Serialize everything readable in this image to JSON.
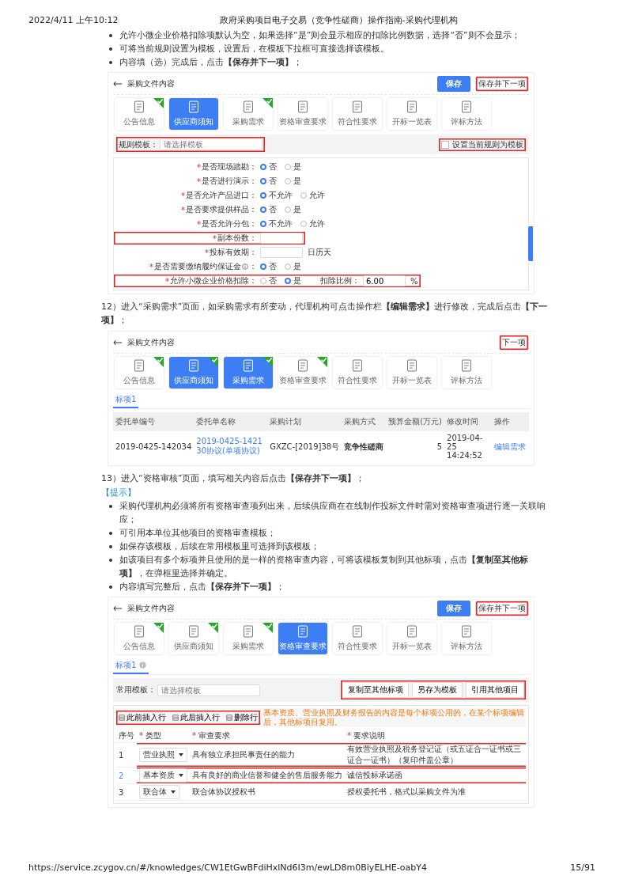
{
  "header": {
    "date": "2022/4/11 上午10:12",
    "title": "政府采购项目电子交易（竞争性磋商）操作指南-采购代理机构"
  },
  "content": [
    {
      "kind": "bullets",
      "items": [
        "允许小微企业价格扣除项默认为空，如果选择“是”则会显示相应的扣除比例数据，选择“否”则不会显示；",
        "可将当前规则设置为模板，设置后，在模板下拉框可直接选择该模板。",
        "内容填（选）完成后，点击**【保存并下一项】**；"
      ]
    },
    {
      "kind": "screenshot",
      "title": "采购文件内容",
      "buttons": [
        {
          "label": "保存",
          "kind": "primary",
          "highlighted": false
        },
        {
          "label": "保存并下一项",
          "kind": "default",
          "highlighted": true
        }
      ],
      "steps": [
        {
          "label": "公告信息",
          "done": true,
          "selected": false
        },
        {
          "label": "供应商须知",
          "done": false,
          "selected": true
        },
        {
          "label": "采购需求",
          "done": true,
          "selected": false
        },
        {
          "label": "资格审查要求",
          "done": false,
          "selected": false
        },
        {
          "label": "符合性要求",
          "done": false,
          "selected": false
        },
        {
          "label": "开标一览表",
          "done": false,
          "selected": false
        },
        {
          "label": "评标方法",
          "done": false,
          "selected": false
        }
      ],
      "template_bar": {
        "label": "规则模板：",
        "placeholder": "请选择模板",
        "highlighted": true,
        "checkbox": {
          "label": "设置当前规则为模板",
          "checked": false,
          "highlighted": true
        }
      },
      "form": [
        {
          "kind": "radio",
          "mark": "*",
          "label": "是否现场踏勘：",
          "highlighted": false,
          "options": [
            {
              "label": "否",
              "selected": true
            },
            {
              "label": "是",
              "selected": false
            }
          ]
        },
        {
          "kind": "radio",
          "mark": "*",
          "label": "是否进行演示：",
          "highlighted": false,
          "options": [
            {
              "label": "否",
              "selected": true
            },
            {
              "label": "是",
              "selected": false
            }
          ]
        },
        {
          "kind": "radio",
          "mark": "*",
          "label": "是否允许产品进口：",
          "highlighted": false,
          "options": [
            {
              "label": "不允许",
              "selected": true
            },
            {
              "label": "允许",
              "selected": false
            }
          ]
        },
        {
          "kind": "radio",
          "mark": "*",
          "label": "是否要求提供样品：",
          "highlighted": false,
          "options": [
            {
              "label": "否",
              "selected": true
            },
            {
              "label": "是",
              "selected": false
            }
          ]
        },
        {
          "kind": "radio",
          "mark": "*",
          "label": "是否允许分包：",
          "highlighted": false,
          "options": [
            {
              "label": "不允许",
              "selected": true
            },
            {
              "label": "允许",
              "selected": false
            }
          ]
        },
        {
          "kind": "input",
          "mark": "*",
          "label": "副本份数：",
          "highlighted": true
        },
        {
          "kind": "input",
          "mark": "*",
          "label": "投标有效期：",
          "highlighted": false,
          "unit": "日历天"
        },
        {
          "kind": "radio",
          "mark": "*",
          "label": "是否需要缴纳履约保证金",
          "label_end": "：",
          "highlighted": false,
          "options": [
            {
              "label": "否",
              "selected": true
            },
            {
              "label": "是",
              "selected": false
            }
          ]
        },
        {
          "kind": "radio",
          "mark": "*",
          "label": "允许小微企业价格扣除：",
          "highlighted": true,
          "options": [
            {
              "label": "否",
              "selected": false
            },
            {
              "label": "是",
              "selected": true
            }
          ],
          "extra": {
            "label": "扣除比例：",
            "value": "6.00",
            "unit": "%"
          }
        }
      ]
    },
    {
      "kind": "paragraph",
      "text": "12）进入“采购需求”页面，如采购需求有所变动，代理机构可点击操作栏**【编辑需求】**进行修改，完成后点击**【下一项】**；"
    },
    {
      "kind": "screenshot",
      "title": "采购文件内容",
      "buttons": [
        {
          "label": "下一项",
          "kind": "default",
          "highlighted": true
        }
      ],
      "steps": [
        {
          "label": "公告信息",
          "done": true,
          "selected": false
        },
        {
          "label": "供应商须知",
          "done": true,
          "selected": true
        },
        {
          "label": "采购需求",
          "done": true,
          "selected": true
        },
        {
          "label": "资格审查要求",
          "done": true,
          "selected": false
        },
        {
          "label": "符合性要求",
          "done": false,
          "selected": false
        },
        {
          "label": "开标一览表",
          "done": false,
          "selected": false
        },
        {
          "label": "评标方法",
          "done": false,
          "selected": false
        }
      ],
      "tab": {
        "label": "标项1",
        "info": false
      },
      "table": {
        "columns": [
          "委托单编号",
          "委托单名称",
          "采购计划",
          "采购方式",
          "预算金额(万元)",
          "修改时间",
          "操作"
        ],
        "rows": [
          {
            "cells": [
              {
                "kind": "text",
                "text": "2019-0425-142034"
              },
              {
                "kind": "link",
                "text": "2019-0425-142130协议(单项协议)"
              },
              {
                "kind": "text",
                "text": "GXZC-[2019]38号"
              },
              {
                "kind": "bold",
                "text": "竞争性磋商"
              },
              {
                "kind": "number",
                "text": "5"
              },
              {
                "kind": "text",
                "text": "2019-04-25 14:24:52"
              },
              {
                "kind": "link",
                "text": "编辑需求"
              }
            ]
          }
        ]
      }
    },
    {
      "kind": "paragraph",
      "text": "13）进入“资格审核”页面，填写相关内容后点击**【保存并下一项】**；"
    },
    {
      "kind": "tip",
      "text": "【提示】"
    },
    {
      "kind": "bullets",
      "items": [
        "采购代理机构必须将所有资格审查项列出来，后续供应商在在线制作投标文件时需对资格审查项进行逐一关联响应；",
        "可引用本单位其他项目的资格审查模板；",
        "如保存该模板，后续在常用模板里可选择到该模板；",
        "如该项目有多个标项并且使用的是一样的资格审查内容，可将该模板复制到其他标项，点击**【复制至其他标项】**，在弹框里选择并确定。",
        "内容填写完整后，点击**【保存并下一项】**；"
      ]
    },
    {
      "kind": "screenshot",
      "title": "采购文件内容",
      "buttons": [
        {
          "label": "保存",
          "kind": "primary",
          "highlighted": false
        },
        {
          "label": "保存并下一项",
          "kind": "default",
          "highlighted": true
        }
      ],
      "steps": [
        {
          "label": "公告信息",
          "done": true,
          "selected": false
        },
        {
          "label": "供应商须知",
          "done": true,
          "selected": false
        },
        {
          "label": "采购需求",
          "done": true,
          "selected": false
        },
        {
          "label": "资格审查要求",
          "done": false,
          "selected": true
        },
        {
          "label": "符合性要求",
          "done": false,
          "selected": false
        },
        {
          "label": "开标一览表",
          "done": false,
          "selected": false
        },
        {
          "label": "评标方法",
          "done": false,
          "selected": false
        }
      ],
      "tab": {
        "label": "标项1",
        "info": true
      },
      "template_bar": {
        "label": "常用模板：",
        "placeholder": "请选择模板",
        "highlighted": false,
        "actions": [
          "复制至其他标项",
          "另存为模板",
          "引用其他项目"
        ],
        "actions_highlighted": true
      },
      "toolbar": {
        "buttons": [
          "此前插入行",
          "此后插入行",
          "删除行"
        ],
        "highlighted": true,
        "notice": "基本资质、营业执照及财务报告的内容是每个标项公用的，在某个标项编辑后，其他标项目复用。"
      },
      "grid": {
        "columns": [
          {
            "label": "序号"
          },
          {
            "label": "类型",
            "mark": "*"
          },
          {
            "label": "审查要求",
            "mark": "*"
          },
          {
            "label": "要求说明",
            "mark": "*"
          }
        ],
        "rows": [
          {
            "number": "1",
            "selected": false,
            "highlighted": true,
            "type": "营业执照",
            "requirement": "具有独立承担民事责任的能力",
            "description": "有效营业执照及税务登记证（或五证合一证书或三证合一证书）（复印件盖公章）"
          },
          {
            "number": "2",
            "selected": true,
            "highlighted": true,
            "type": "基本资质",
            "requirement": "具有良好的商业信誉和健全的售后服务能力",
            "description": "诚信投标承诺函"
          },
          {
            "number": "3",
            "selected": false,
            "highlighted": false,
            "type": "联合体",
            "requirement": "联合体协议授权书",
            "description": "授权委托书，格式以采购文件为准"
          }
        ]
      }
    }
  ],
  "footer": {
    "url": "https://service.zcygov.cn/#/knowledges/CW1EtGwBFdiHxlNd6I3m/ewLD8m0BiyELHE-oabY4",
    "page": "15/91"
  }
}
